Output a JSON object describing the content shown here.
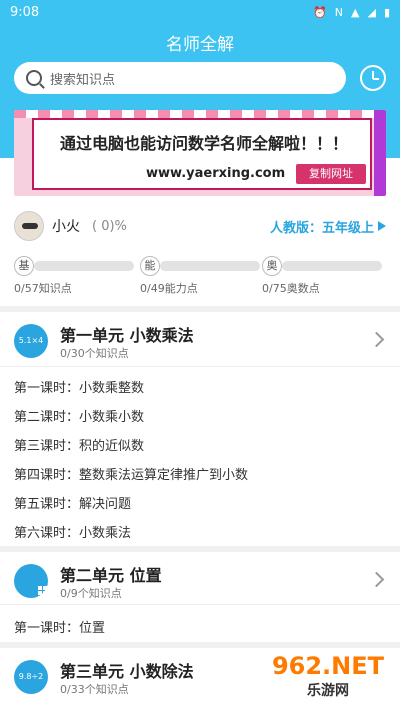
{
  "status": {
    "time": "9:08",
    "icons": [
      "alarm-icon",
      "nfc-icon",
      "wifi-icon",
      "signal-icon",
      "battery-icon"
    ]
  },
  "header": {
    "title": "名师全解",
    "search_placeholder": "搜索知识点"
  },
  "banner": {
    "text": "通过电脑也能访问数学名师全解啦！！！",
    "url": "www.yaerxing.com",
    "copy_button": "复制网址"
  },
  "user": {
    "name": "小火",
    "progress": "( 0)%",
    "grade": "人教版：五年级上"
  },
  "stats": [
    {
      "badge": "基",
      "caption": "0/57知识点",
      "progress": 0
    },
    {
      "badge": "能",
      "caption": "0/49能力点",
      "progress": 0
    },
    {
      "badge": "奥",
      "caption": "0/75奥数点",
      "progress": 0
    }
  ],
  "units": [
    {
      "icon_text": "5.1×4",
      "title": "第一单元  小数乘法",
      "subtitle": "0/30个知识点",
      "lessons": [
        "第一课时：小数乘整数",
        "第二课时：小数乘小数",
        "第三课时：积的近似数",
        "第四课时：整数乘法运算定律推广到小数",
        "第五课时：解决问题",
        "第六课时：小数乘法"
      ]
    },
    {
      "icon_text": "",
      "title": "第二单元  位置",
      "subtitle": "0/9个知识点",
      "lessons": [
        "第一课时：位置"
      ]
    },
    {
      "icon_text": "9.8÷2",
      "title": "第三单元  小数除法",
      "subtitle": "0/33个知识点",
      "lessons": []
    }
  ],
  "watermark": {
    "logo": "962.NET",
    "sub": "乐游网"
  },
  "colors": {
    "accent": "#3dc3f2",
    "link": "#2ba5e0",
    "banner_button": "#d6336c"
  }
}
